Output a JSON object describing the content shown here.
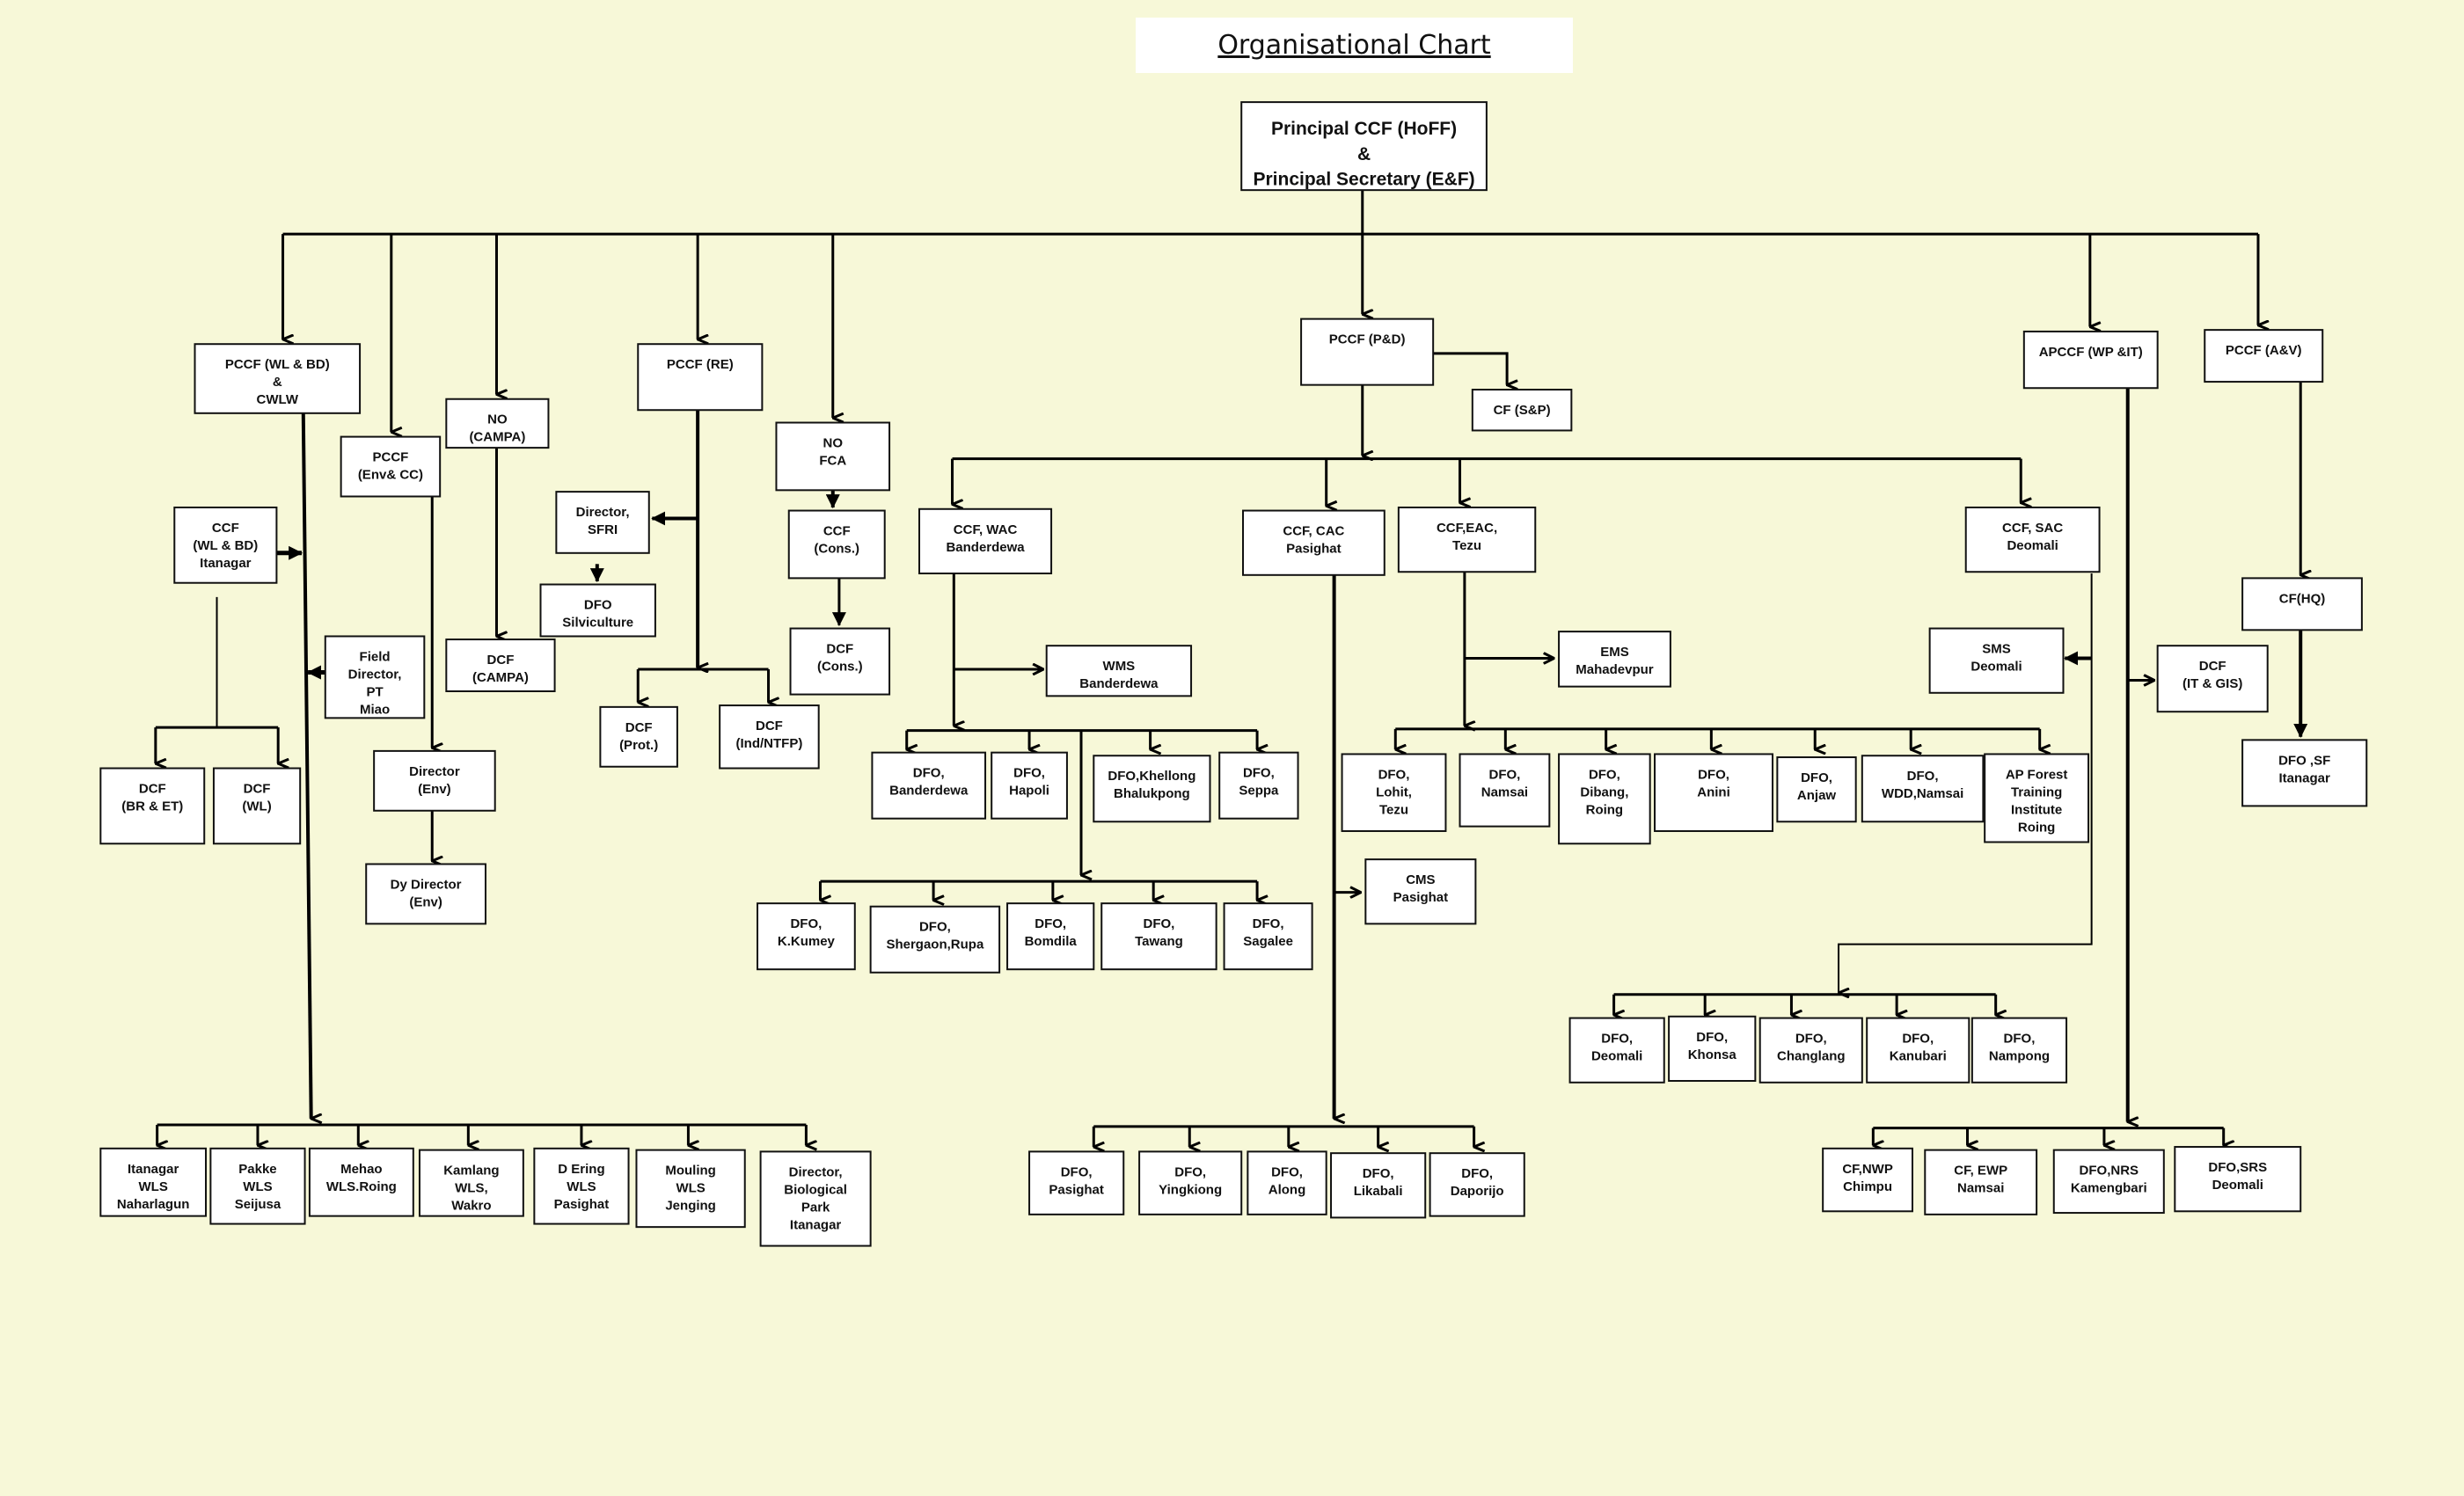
{
  "title": "Organisational Chart",
  "nodes": {
    "root": [
      "Principal CCF (HoFF)",
      "&",
      "Principal Secretary (E&F)"
    ],
    "pccf_wlbd": [
      "PCCF (WL & BD)",
      "&",
      "CWLW"
    ],
    "pccf_envcc": [
      "PCCF",
      "(Env& CC)"
    ],
    "no_campa": [
      "NO",
      "(CAMPA)"
    ],
    "pccf_re": [
      "PCCF (RE)"
    ],
    "no_fca": [
      "NO",
      "FCA"
    ],
    "pccf_pd": [
      "PCCF (P&D)"
    ],
    "cf_sp": [
      "CF (S&P)"
    ],
    "apccf_wpit": [
      "APCCF (WP &IT)"
    ],
    "pccf_av": [
      "PCCF (A&V)"
    ],
    "ccf_wlbd_itanagar": [
      "CCF",
      "(WL & BD)",
      "Itanagar"
    ],
    "field_director": [
      "Field",
      "Director,",
      "PT",
      "Miao"
    ],
    "dcf_br_et": [
      "DCF",
      "(BR & ET)"
    ],
    "dcf_wl": [
      "DCF",
      "(WL)"
    ],
    "director_env": [
      "Director",
      "(Env)"
    ],
    "dy_director_env": [
      "Dy Director",
      "(Env)"
    ],
    "dcf_campa": [
      "DCF",
      "(CAMPA)"
    ],
    "director_sfri": [
      "Director,",
      "SFRI"
    ],
    "dfo_silviculture": [
      "DFO",
      "Silviculture"
    ],
    "dcf_prot": [
      "DCF",
      "(Prot.)"
    ],
    "dcf_ind_ntfp": [
      "DCF",
      "(Ind/NTFP)"
    ],
    "ccf_cons": [
      "CCF",
      "(Cons.)"
    ],
    "dcf_cons": [
      "DCF",
      "(Cons.)"
    ],
    "ccf_wac": [
      "CCF, WAC",
      "Banderdewa"
    ],
    "wms_banderdewa": [
      "WMS",
      "Banderdewa"
    ],
    "ccf_cac": [
      "CCF, CAC",
      "Pasighat"
    ],
    "cms_pasighat": [
      "CMS",
      "Pasighat"
    ],
    "ccf_eac": [
      "CCF,EAC,",
      "Tezu"
    ],
    "ems_mahadevpur": [
      "EMS",
      "Mahadevpur"
    ],
    "ccf_sac": [
      "CCF, SAC",
      "Deomali"
    ],
    "sms_deomali": [
      "SMS",
      "Deomali"
    ],
    "dcf_itgis": [
      "DCF",
      "(IT & GIS)"
    ],
    "cf_hq": [
      "CF(HQ)"
    ],
    "dfo_sf": [
      "DFO ,SF",
      "Itanagar"
    ],
    "wac_row1": [
      [
        "DFO,",
        "Banderdewa"
      ],
      [
        "DFO,",
        "Hapoli"
      ],
      [
        "DFO,Khellong",
        "Bhalukpong"
      ],
      [
        "DFO,",
        "Seppa"
      ]
    ],
    "wac_row2": [
      [
        "DFO,",
        "K.Kumey"
      ],
      [
        "DFO,",
        "Shergaon,Rupa"
      ],
      [
        "DFO,",
        "Bomdila"
      ],
      [
        "DFO,",
        "Tawang"
      ],
      [
        "DFO,",
        "Sagalee"
      ]
    ],
    "eac_row": [
      [
        "DFO,",
        "Lohit,",
        "Tezu"
      ],
      [
        "DFO,",
        "Namsai"
      ],
      [
        "DFO,",
        "Dibang,",
        "Roing"
      ],
      [
        "DFO,",
        "Anini"
      ],
      [
        "DFO,",
        "Anjaw"
      ],
      [
        "DFO,",
        "WDD,Namsai"
      ],
      [
        "AP Forest",
        "Training",
        "Institute",
        "Roing"
      ]
    ],
    "sac_row": [
      [
        "DFO,",
        "Deomali"
      ],
      [
        "DFO,",
        "Khonsa"
      ],
      [
        "DFO,",
        "Changlang"
      ],
      [
        "DFO,",
        "Kanubari"
      ],
      [
        "DFO,",
        "Nampong"
      ]
    ],
    "cac_row": [
      [
        "DFO,",
        "Pasighat"
      ],
      [
        "DFO,",
        "Yingkiong"
      ],
      [
        "DFO,",
        "Along"
      ],
      [
        "DFO,",
        "Likabali"
      ],
      [
        "DFO,",
        "Daporijo"
      ]
    ],
    "wlbd_row": [
      [
        "Itanagar",
        "WLS",
        "Naharlagun"
      ],
      [
        "Pakke",
        "WLS",
        "Seijusa"
      ],
      [
        "Mehao",
        "WLS.Roing"
      ],
      [
        "Kamlang",
        "WLS,",
        "Wakro"
      ],
      [
        "D Ering",
        "WLS",
        "Pasighat"
      ],
      [
        "Mouling",
        "WLS",
        "Jenging"
      ],
      [
        "Director,",
        "Biological",
        "Park",
        "Itanagar"
      ]
    ],
    "wpit_row": [
      [
        "CF,NWP",
        "Chimpu"
      ],
      [
        "CF, EWP",
        "Namsai"
      ],
      [
        "DFO,NRS",
        "Kamengbari"
      ],
      [
        "DFO,SRS",
        "Deomali"
      ]
    ]
  }
}
